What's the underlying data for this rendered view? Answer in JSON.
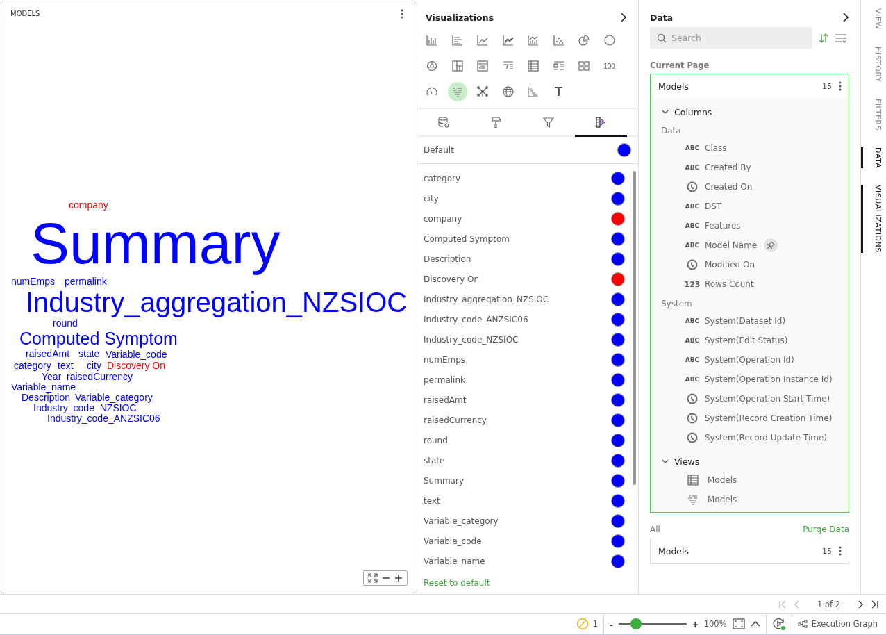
{
  "canvas": {
    "title": "MODELS"
  },
  "word_cloud": {
    "words": [
      {
        "text": "company",
        "color": "#ff0000"
      },
      {
        "text": "Summary",
        "color": "#0000ff"
      },
      {
        "text": "numEmps",
        "color": "#0000ff"
      },
      {
        "text": "permalink",
        "color": "#0000ff"
      },
      {
        "text": "Industry_aggregation_NZSIOC",
        "color": "#0000ff"
      },
      {
        "text": "round",
        "color": "#0000ff"
      },
      {
        "text": "Computed Symptom",
        "color": "#0000ff"
      },
      {
        "text": "raisedAmt",
        "color": "#0000ff"
      },
      {
        "text": "state",
        "color": "#0000ff"
      },
      {
        "text": "Variable_code",
        "color": "#0000ff"
      },
      {
        "text": "category",
        "color": "#0000ff"
      },
      {
        "text": "text",
        "color": "#0000ff"
      },
      {
        "text": "city",
        "color": "#0000ff"
      },
      {
        "text": "Discovery On",
        "color": "#ff0000"
      },
      {
        "text": "Year",
        "color": "#0000ff"
      },
      {
        "text": "raisedCurrency",
        "color": "#0000ff"
      },
      {
        "text": "Variable_name",
        "color": "#0000ff"
      },
      {
        "text": "Description",
        "color": "#0000ff"
      },
      {
        "text": "Variable_category",
        "color": "#0000ff"
      },
      {
        "text": "Industry_code_NZSIOC",
        "color": "#0000ff"
      },
      {
        "text": "Industry_code_ANZSIC06",
        "color": "#0000ff"
      }
    ]
  },
  "visualizations": {
    "title": "Visualizations",
    "chart_types": [
      {
        "kind": "column",
        "selected": false
      },
      {
        "kind": "bar",
        "selected": false
      },
      {
        "kind": "line",
        "selected": false
      },
      {
        "kind": "area",
        "selected": false
      },
      {
        "kind": "combo",
        "selected": false
      },
      {
        "kind": "scatter",
        "selected": false
      },
      {
        "kind": "pie",
        "selected": false
      },
      {
        "kind": "donut",
        "selected": false
      },
      {
        "kind": "sunburst",
        "selected": false
      },
      {
        "kind": "treemap",
        "selected": false
      },
      {
        "kind": "pivot",
        "selected": false
      },
      {
        "kind": "filterlist",
        "selected": false
      },
      {
        "kind": "table",
        "selected": false
      },
      {
        "kind": "list",
        "selected": false
      },
      {
        "kind": "tiles",
        "selected": false
      },
      {
        "kind": "number",
        "label": "100",
        "selected": false
      },
      {
        "kind": "gauge",
        "selected": false
      },
      {
        "kind": "wordcloud",
        "selected": true
      },
      {
        "kind": "network",
        "selected": false
      },
      {
        "kind": "globe",
        "selected": false
      },
      {
        "kind": "waterfall",
        "selected": false
      },
      {
        "kind": "text",
        "label": "T",
        "selected": false
      }
    ],
    "tabs": [
      {
        "kind": "data",
        "selected": false
      },
      {
        "kind": "format",
        "selected": false
      },
      {
        "kind": "filter",
        "selected": false
      },
      {
        "kind": "colors",
        "selected": true
      }
    ],
    "default": {
      "label": "Default",
      "color": "#0000ff"
    },
    "fields": [
      {
        "name": "category",
        "color": "#0000ff"
      },
      {
        "name": "city",
        "color": "#0000ff"
      },
      {
        "name": "company",
        "color": "#ff0000"
      },
      {
        "name": "Computed Symptom",
        "color": "#0000ff"
      },
      {
        "name": "Description",
        "color": "#0000ff"
      },
      {
        "name": "Discovery On",
        "color": "#ff0000"
      },
      {
        "name": "Industry_aggregation_NZSIOC",
        "color": "#0000ff"
      },
      {
        "name": "Industry_code_ANZSIC06",
        "color": "#0000ff"
      },
      {
        "name": "Industry_code_NZSIOC",
        "color": "#0000ff"
      },
      {
        "name": "numEmps",
        "color": "#0000ff"
      },
      {
        "name": "permalink",
        "color": "#0000ff"
      },
      {
        "name": "raisedAmt",
        "color": "#0000ff"
      },
      {
        "name": "raisedCurrency",
        "color": "#0000ff"
      },
      {
        "name": "round",
        "color": "#0000ff"
      },
      {
        "name": "state",
        "color": "#0000ff"
      },
      {
        "name": "Summary",
        "color": "#0000ff"
      },
      {
        "name": "text",
        "color": "#0000ff"
      },
      {
        "name": "Variable_category",
        "color": "#0000ff"
      },
      {
        "name": "Variable_code",
        "color": "#0000ff"
      },
      {
        "name": "Variable_name",
        "color": "#0000ff"
      }
    ],
    "reset_link": "Reset to default"
  },
  "data_panel": {
    "title": "Data",
    "search": {
      "placeholder": "Search"
    },
    "current_page_label": "Current Page",
    "current_dataset": {
      "name": "Models",
      "count": "15",
      "columns": {
        "label": "Columns",
        "expanded": true,
        "groups": [
          {
            "name": "Data",
            "fields": [
              {
                "kind": "text",
                "type_label": "ABC",
                "name": "Class",
                "hovered": false
              },
              {
                "kind": "text",
                "type_label": "ABC",
                "name": "Created By",
                "hovered": false
              },
              {
                "kind": "datetime",
                "name": "Created On",
                "hovered": false
              },
              {
                "kind": "text",
                "type_label": "ABC",
                "name": "DST",
                "hovered": false
              },
              {
                "kind": "text",
                "type_label": "ABC",
                "name": "Features",
                "hovered": false
              },
              {
                "kind": "text",
                "type_label": "ABC",
                "name": "Model Name",
                "hovered": true
              },
              {
                "kind": "datetime",
                "name": "Modified On",
                "hovered": false
              },
              {
                "kind": "number",
                "type_label": "123",
                "name": "Rows Count",
                "hovered": false
              }
            ]
          },
          {
            "name": "System",
            "fields": [
              {
                "kind": "text",
                "type_label": "ABC",
                "name": "System(Dataset Id)",
                "hovered": false
              },
              {
                "kind": "text",
                "type_label": "ABC",
                "name": "System(Edit Status)",
                "hovered": false
              },
              {
                "kind": "text",
                "type_label": "ABC",
                "name": "System(Operation Id)",
                "hovered": false
              },
              {
                "kind": "text",
                "type_label": "ABC",
                "name": "System(Operation Instance Id)",
                "hovered": false
              },
              {
                "kind": "datetime",
                "name": "System(Operation Start Time)",
                "hovered": false
              },
              {
                "kind": "datetime",
                "name": "System(Record Creation Time)",
                "hovered": false
              },
              {
                "kind": "datetime",
                "name": "System(Record Update Time)",
                "hovered": false
              }
            ]
          }
        ]
      },
      "views": {
        "label": "Views",
        "expanded": true,
        "items": [
          {
            "kind": "table",
            "name": "Models"
          },
          {
            "kind": "wordcloud",
            "name": "Models"
          }
        ]
      }
    },
    "all_label": "All",
    "purge_link": "Purge Data",
    "all_datasets": [
      {
        "name": "Models",
        "count": "15"
      }
    ]
  },
  "side_tabs": [
    {
      "label": "VIEW",
      "selected": false
    },
    {
      "label": "HISTORY",
      "selected": false
    },
    {
      "label": "FILTERS",
      "selected": false
    },
    {
      "label": "DATA",
      "selected": true
    },
    {
      "label": "VISUALIZATIONS",
      "selected": true
    }
  ],
  "pager": {
    "text": "1 of 2"
  },
  "status_bar": {
    "warnings": "1",
    "zoom": {
      "minus": "-",
      "plus": "+",
      "level": 0.26,
      "reading": "100%"
    },
    "execution_graph": "Execution Graph"
  }
}
